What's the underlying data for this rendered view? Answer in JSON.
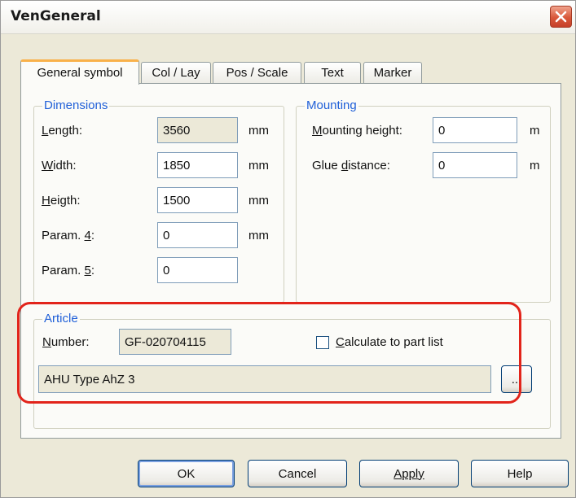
{
  "window": {
    "title": "VenGeneral"
  },
  "tabs": [
    "General symbol",
    "Col / Lay",
    "Pos / Scale",
    "Text",
    "Marker"
  ],
  "dimensions": {
    "legend": "Dimensions",
    "length": {
      "label": "Length:",
      "value": "3560",
      "unit": "mm"
    },
    "width": {
      "label": "Width:",
      "value": "1850",
      "unit": "mm"
    },
    "heigth": {
      "label": "Heigth:",
      "value": "1500",
      "unit": "mm"
    },
    "param4": {
      "label": "Param. 4:",
      "value": "0",
      "unit": "mm"
    },
    "param5": {
      "label": "Param. 5:",
      "value": "0"
    }
  },
  "mounting": {
    "legend": "Mounting",
    "height": {
      "label": "Mounting height:",
      "value": "0",
      "unit": "m"
    },
    "glue": {
      "label": "Glue distance:",
      "value": "0",
      "unit": "m"
    }
  },
  "article": {
    "legend": "Article",
    "number_label": "Number:",
    "number_value": "GF-020704115",
    "checkbox_label": "Calculate to part list",
    "checkbox_checked": false,
    "description": "AHU Type AhZ 3",
    "browse_label": "..."
  },
  "buttons": {
    "ok": "OK",
    "cancel": "Cancel",
    "apply": "Apply",
    "help": "Help"
  },
  "colors": {
    "highlight": "#e2241b",
    "legend": "#1f5fd8",
    "active_tab_accent": "#f9b14a"
  }
}
